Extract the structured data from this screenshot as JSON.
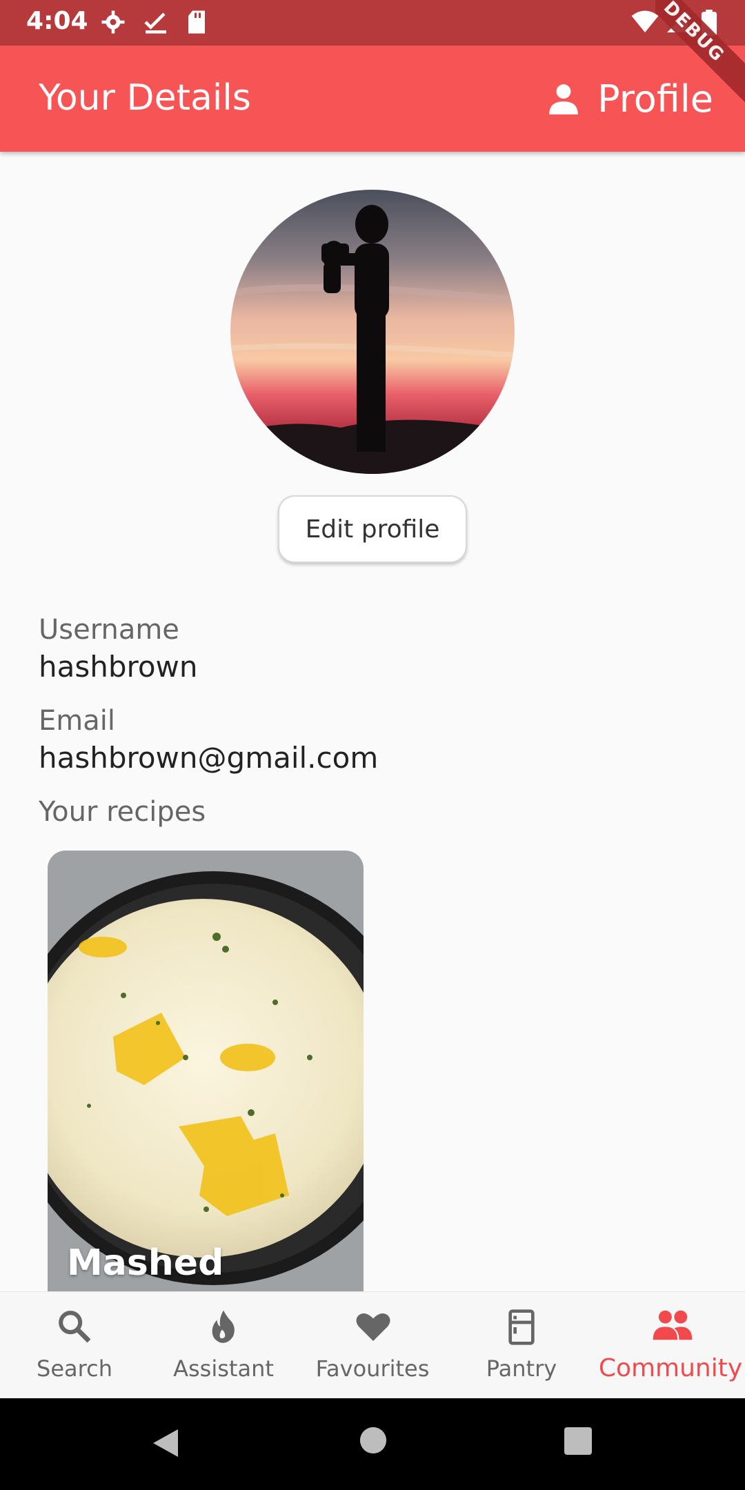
{
  "status_bar": {
    "time": "4:04"
  },
  "app_bar": {
    "title": "Your Details",
    "action_label": "Profile",
    "debug_banner": "DEBUG"
  },
  "profile": {
    "edit_button": "Edit profile",
    "username_label": "Username",
    "username_value": "hashbrown",
    "email_label": "Email",
    "email_value": "hashbrown@gmail.com",
    "recipes_label": "Your recipes"
  },
  "recipes": [
    {
      "title": "Mashed"
    }
  ],
  "bottom_nav": {
    "items": [
      {
        "label": "Search",
        "icon": "search-icon"
      },
      {
        "label": "Assistant",
        "icon": "flame-icon"
      },
      {
        "label": "Favourites",
        "icon": "heart-icon"
      },
      {
        "label": "Pantry",
        "icon": "fridge-icon"
      },
      {
        "label": "Community",
        "icon": "people-icon"
      }
    ],
    "active": "Community"
  },
  "colors": {
    "app_bar": "#f65455",
    "status_bar": "#b63a3c",
    "accent": "#f04a4d",
    "background": "#fafafa"
  }
}
